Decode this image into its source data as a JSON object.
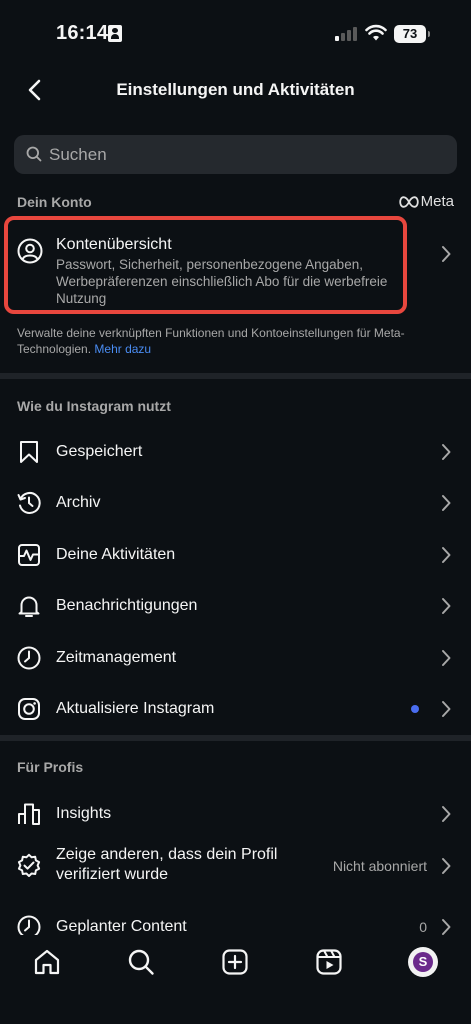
{
  "status_bar": {
    "time": "16:14",
    "battery": "73"
  },
  "header": {
    "title": "Einstellungen und Aktivitäten"
  },
  "search": {
    "placeholder": "Suchen"
  },
  "your_account": {
    "label": "Dein Konto",
    "meta_brand": "Meta",
    "account_center": {
      "title": "Kontenübersicht",
      "subtitle": "Passwort, Sicherheit, personenbezogene Angaben, Werbepräferenzen einschließlich Abo für die werbefreie Nutzung"
    },
    "info_text": "Verwalte deine verknüpften Funktionen und Kontoeinstellungen für Meta-Technologien.",
    "info_link": "Mehr dazu"
  },
  "how_you_use": {
    "label": "Wie du Instagram nutzt",
    "items": [
      {
        "label": "Gespeichert",
        "icon": "bookmark-icon"
      },
      {
        "label": "Archiv",
        "icon": "archive-icon"
      },
      {
        "label": "Deine Aktivitäten",
        "icon": "activity-icon"
      },
      {
        "label": "Benachrichtigungen",
        "icon": "bell-icon"
      },
      {
        "label": "Zeitmanagement",
        "icon": "clock-icon"
      },
      {
        "label": "Aktualisiere Instagram",
        "icon": "instagram-icon"
      }
    ]
  },
  "for_pros": {
    "label": "Für Profis",
    "items": [
      {
        "label": "Insights",
        "icon": "insights-icon"
      },
      {
        "label": "Zeige anderen, dass dein Profil verifiziert wurde",
        "value": "Nicht abonniert",
        "icon": "verified-badge-icon"
      },
      {
        "label": "Geplanter Content",
        "value": "0",
        "icon": "scheduled-clock-icon"
      }
    ]
  },
  "tabbar": {
    "items": [
      "home-icon",
      "search-icon",
      "create-icon",
      "reels-icon",
      "profile-avatar"
    ],
    "avatar_letter": "S"
  },
  "colors": {
    "background": "#0c1014",
    "highlight": "#e8473e",
    "link": "#4a8cf2",
    "dot": "#4a6df0"
  }
}
